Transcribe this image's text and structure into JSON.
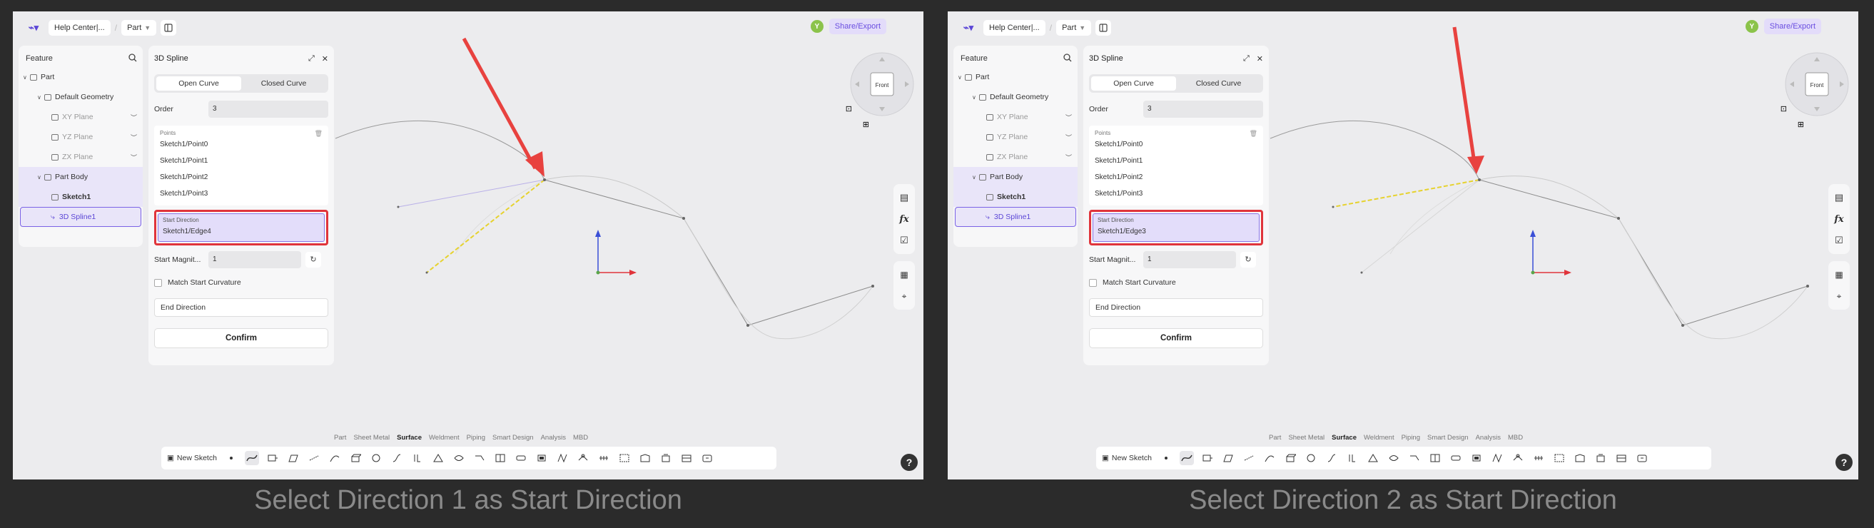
{
  "panels": [
    {
      "caption": "Select Direction 1 as Start Direction",
      "start_direction_value": "Sketch1/Edge4"
    },
    {
      "caption": "Select Direction 2 as Start Direction",
      "start_direction_value": "Sketch1/Edge3"
    }
  ],
  "topbar": {
    "help_center": "Help Center|...",
    "part_menu": "Part",
    "share_export": "Share/Export",
    "avatar_initial": "Y"
  },
  "tree": {
    "header": "Feature",
    "items": [
      {
        "label": "Part"
      },
      {
        "label": "Default Geometry"
      },
      {
        "label": "XY Plane"
      },
      {
        "label": "YZ Plane"
      },
      {
        "label": "ZX Plane"
      },
      {
        "label": "Part Body"
      },
      {
        "label": "Sketch1"
      },
      {
        "label": "3D Spline1"
      }
    ]
  },
  "dialog": {
    "title": "3D Spline",
    "open_curve": "Open Curve",
    "closed_curve": "Closed Curve",
    "order_label": "Order",
    "order_value": "3",
    "points_caption": "Points",
    "points": [
      "Sketch1/Point0",
      "Sketch1/Point1",
      "Sketch1/Point2",
      "Sketch1/Point3"
    ],
    "start_direction_caption": "Start Direction",
    "start_magnitude_label": "Start Magnit...",
    "start_magnitude_value": "1",
    "match_start_curvature": "Match Start Curvature",
    "end_direction": "End Direction",
    "confirm": "Confirm"
  },
  "view_cube": {
    "face_label": "Front"
  },
  "modes": [
    "Part",
    "Sheet Metal",
    "Surface",
    "Weldment",
    "Piping",
    "Smart Design",
    "Analysis",
    "MBD"
  ],
  "active_mode": "Surface",
  "toolbar": {
    "new_sketch": "New Sketch"
  },
  "help_glyph": "?",
  "colors": {
    "accent": "#6a4ee0",
    "highlight_box": "#e0343b",
    "arrow": "#e8423f",
    "direction_line": "#e6d22e"
  }
}
